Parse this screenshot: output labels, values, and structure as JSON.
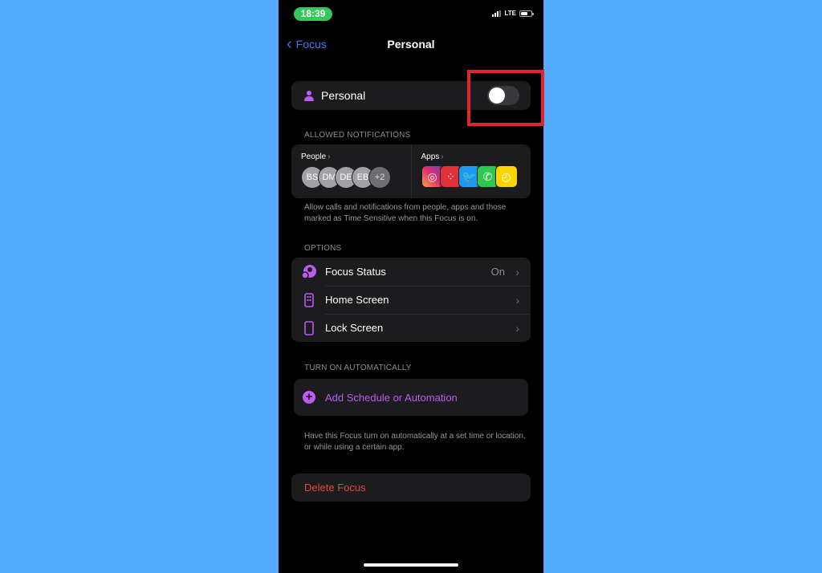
{
  "status_bar": {
    "time": "18:39",
    "network": "LTE",
    "battery_level": 0.7
  },
  "nav": {
    "back_label": "Focus",
    "title": "Personal"
  },
  "focus_toggle": {
    "label": "Personal",
    "enabled": false
  },
  "allowed_notifications": {
    "section_label": "ALLOWED NOTIFICATIONS",
    "people": {
      "label": "People",
      "chevron": "›",
      "avatars": [
        "BS",
        "DM",
        "DE",
        "EB"
      ],
      "more": "+2"
    },
    "apps": {
      "label": "Apps",
      "chevron": "›",
      "items": [
        {
          "name": "Instagram",
          "glyph": "◎"
        },
        {
          "name": "Red dotted app",
          "glyph": "⁘"
        },
        {
          "name": "Twitter",
          "glyph": "🐦"
        },
        {
          "name": "WhatsApp",
          "glyph": "✆"
        },
        {
          "name": "Clock",
          "glyph": "◴"
        }
      ]
    },
    "help_text": "Allow calls and notifications from people, apps and those marked as Time Sensitive when this Focus is on."
  },
  "options": {
    "section_label": "OPTIONS",
    "items": [
      {
        "label": "Focus Status",
        "value": "On",
        "icon": "focus-status-icon"
      },
      {
        "label": "Home Screen",
        "value": "",
        "icon": "home-screen-icon"
      },
      {
        "label": "Lock Screen",
        "value": "",
        "icon": "lock-screen-icon"
      }
    ],
    "chevron": "›"
  },
  "turn_on_automatically": {
    "section_label": "TURN ON AUTOMATICALLY",
    "add_label": "Add Schedule or Automation",
    "plus_glyph": "+",
    "help_text": "Have this Focus turn on automatically at a set time or location, or while using a certain app."
  },
  "delete": {
    "label": "Delete Focus"
  },
  "colors": {
    "accent_purple": "#bf5af2",
    "link_blue": "#3478f6",
    "destructive_red": "#e5483f",
    "highlight_red": "#e0262c",
    "background_blue": "#55abfd"
  }
}
